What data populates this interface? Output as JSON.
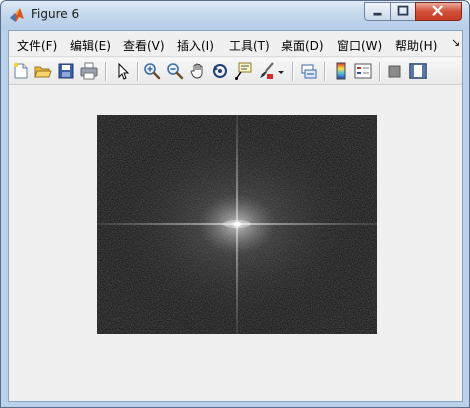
{
  "window": {
    "title": "Figure 6",
    "controls": {
      "minimize": "minimize",
      "maximize": "maximize",
      "close": "close"
    }
  },
  "menubar": {
    "items": [
      {
        "label": "文件(F)"
      },
      {
        "label": "编辑(E)"
      },
      {
        "label": "查看(V)"
      },
      {
        "label": "插入(I)"
      },
      {
        "label": "工具(T)"
      },
      {
        "label": "桌面(D)"
      },
      {
        "label": "窗口(W)"
      },
      {
        "label": "帮助(H)"
      }
    ],
    "overflow": "↘"
  },
  "toolbar": {
    "buttons": [
      {
        "name": "new-figure",
        "icon": "new-document-icon"
      },
      {
        "name": "open-file",
        "icon": "open-folder-icon"
      },
      {
        "name": "save",
        "icon": "save-disk-icon"
      },
      {
        "name": "print",
        "icon": "printer-icon"
      },
      {
        "name": "edit-plot",
        "icon": "arrow-pointer-icon"
      },
      {
        "name": "zoom-in",
        "icon": "zoom-in-icon"
      },
      {
        "name": "zoom-out",
        "icon": "zoom-out-icon"
      },
      {
        "name": "pan",
        "icon": "hand-icon"
      },
      {
        "name": "rotate-3d",
        "icon": "rotate-icon"
      },
      {
        "name": "data-cursor",
        "icon": "data-cursor-icon"
      },
      {
        "name": "brush",
        "icon": "brush-icon"
      },
      {
        "name": "link-plot",
        "icon": "link-icon"
      },
      {
        "name": "colorbar",
        "icon": "colorbar-icon"
      },
      {
        "name": "legend",
        "icon": "legend-icon"
      },
      {
        "name": "hide-plot-tools",
        "icon": "hide-tools-icon"
      },
      {
        "name": "show-plot-tools",
        "icon": "show-tools-icon"
      }
    ]
  },
  "figure": {
    "description_colors": {
      "background": "#141414",
      "center_glow": "#ffffff"
    }
  }
}
